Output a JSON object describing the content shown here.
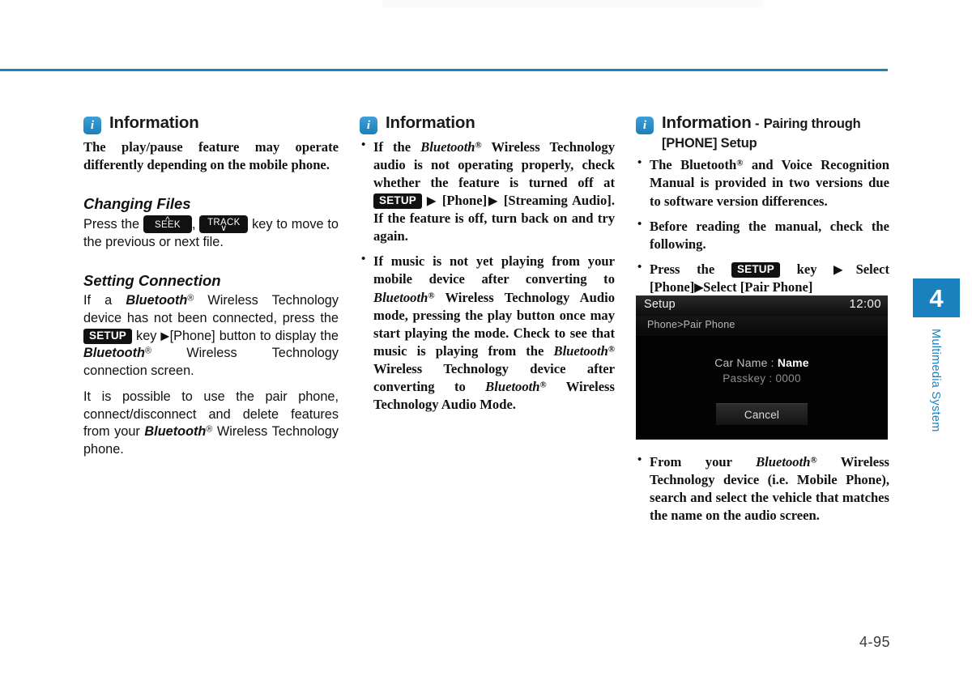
{
  "page": {
    "number": "4-95",
    "accent_color": "#1a80be",
    "tab": {
      "chapter_number": "4",
      "chapter_label": "Multimedia System"
    }
  },
  "column_left": {
    "info": {
      "icon": "info-icon",
      "title": "Information",
      "body": "The play/pause feature may operate differently depending on the mobile phone."
    },
    "section_changing_files": {
      "heading": "Changing Files",
      "text_before": "Press the",
      "key_seek": {
        "label": "SEEK",
        "chevron": "up"
      },
      "comma": ",",
      "key_track": {
        "label": "TRACK",
        "chevron": "down"
      },
      "text_after": "key to move to the previous or next file."
    },
    "section_setting_connection": {
      "heading": "Setting Connection",
      "p1_a": "If a",
      "p1_bt": "Bluetooth",
      "p1_b": "Wireless Technology device has not been connected, press the",
      "p1_key": "SETUP",
      "p1_c": "key",
      "p1_arrow": "▶",
      "p1_d": "[Phone] button to display the",
      "p1_bt2": "Bluetooth",
      "p1_e": "Wireless Technology connection screen.",
      "p2_a": "It is possible to use the pair phone, connect/disconnect and delete features from your",
      "p2_bt": "Bluetooth",
      "p2_b": "Wireless Technology phone."
    }
  },
  "column_middle": {
    "info": {
      "icon": "info-icon",
      "title": "Information"
    },
    "bullets": [
      {
        "a": "If the",
        "bt": "Bluetooth",
        "b": "Wireless Technology audio is not operating properly, check whether the feature is turned off at",
        "key": "SETUP",
        "arrow1": "▶",
        "c": "[Phone]",
        "arrow2": "▶",
        "d": "[Streaming Audio]. If the feature is off, turn back on and try again."
      },
      {
        "a": "If music is not yet playing from your mobile device after converting to",
        "bt1": "Bluetooth",
        "b": "Wireless Technology Audio mode, pressing the play button once may start playing the mode. Check to see that music is playing from the",
        "bt2": "Bluetooth",
        "c": "Wireless Technology device after converting to",
        "bt3": "Bluetooth",
        "d": "Wireless Technology Audio Mode."
      }
    ]
  },
  "column_right": {
    "info": {
      "icon": "info-icon",
      "title": "Information",
      "subtitle_dash": "-",
      "subtitle": "Pairing through [PHONE] Setup"
    },
    "bullets": [
      {
        "a": "The Bluetooth",
        "b": "and Voice Recognition Manual is provided in two versions due to software version differences."
      },
      {
        "a": "Before reading the manual, check the following."
      },
      {
        "a": "Press the",
        "key": "SETUP",
        "b": "key",
        "arrow1": "▶",
        "c": "Select [Phone]",
        "arrow2": "▶",
        "d": "Select [Pair Phone]"
      }
    ],
    "headunit": {
      "title": "Setup",
      "clock": "12:00",
      "breadcrumb": "Phone>Pair Phone",
      "car_name_label": "Car Name :",
      "car_name_value": "Name",
      "passkey_label": "Passkey :",
      "passkey_value": "0000",
      "cancel_label": "Cancel"
    },
    "bullet_after_image": {
      "a": "From your",
      "bt": "Bluetooth",
      "b": "Wireless Technology device (i.e. Mobile Phone), search and select the vehicle that matches the name on the audio screen."
    }
  }
}
